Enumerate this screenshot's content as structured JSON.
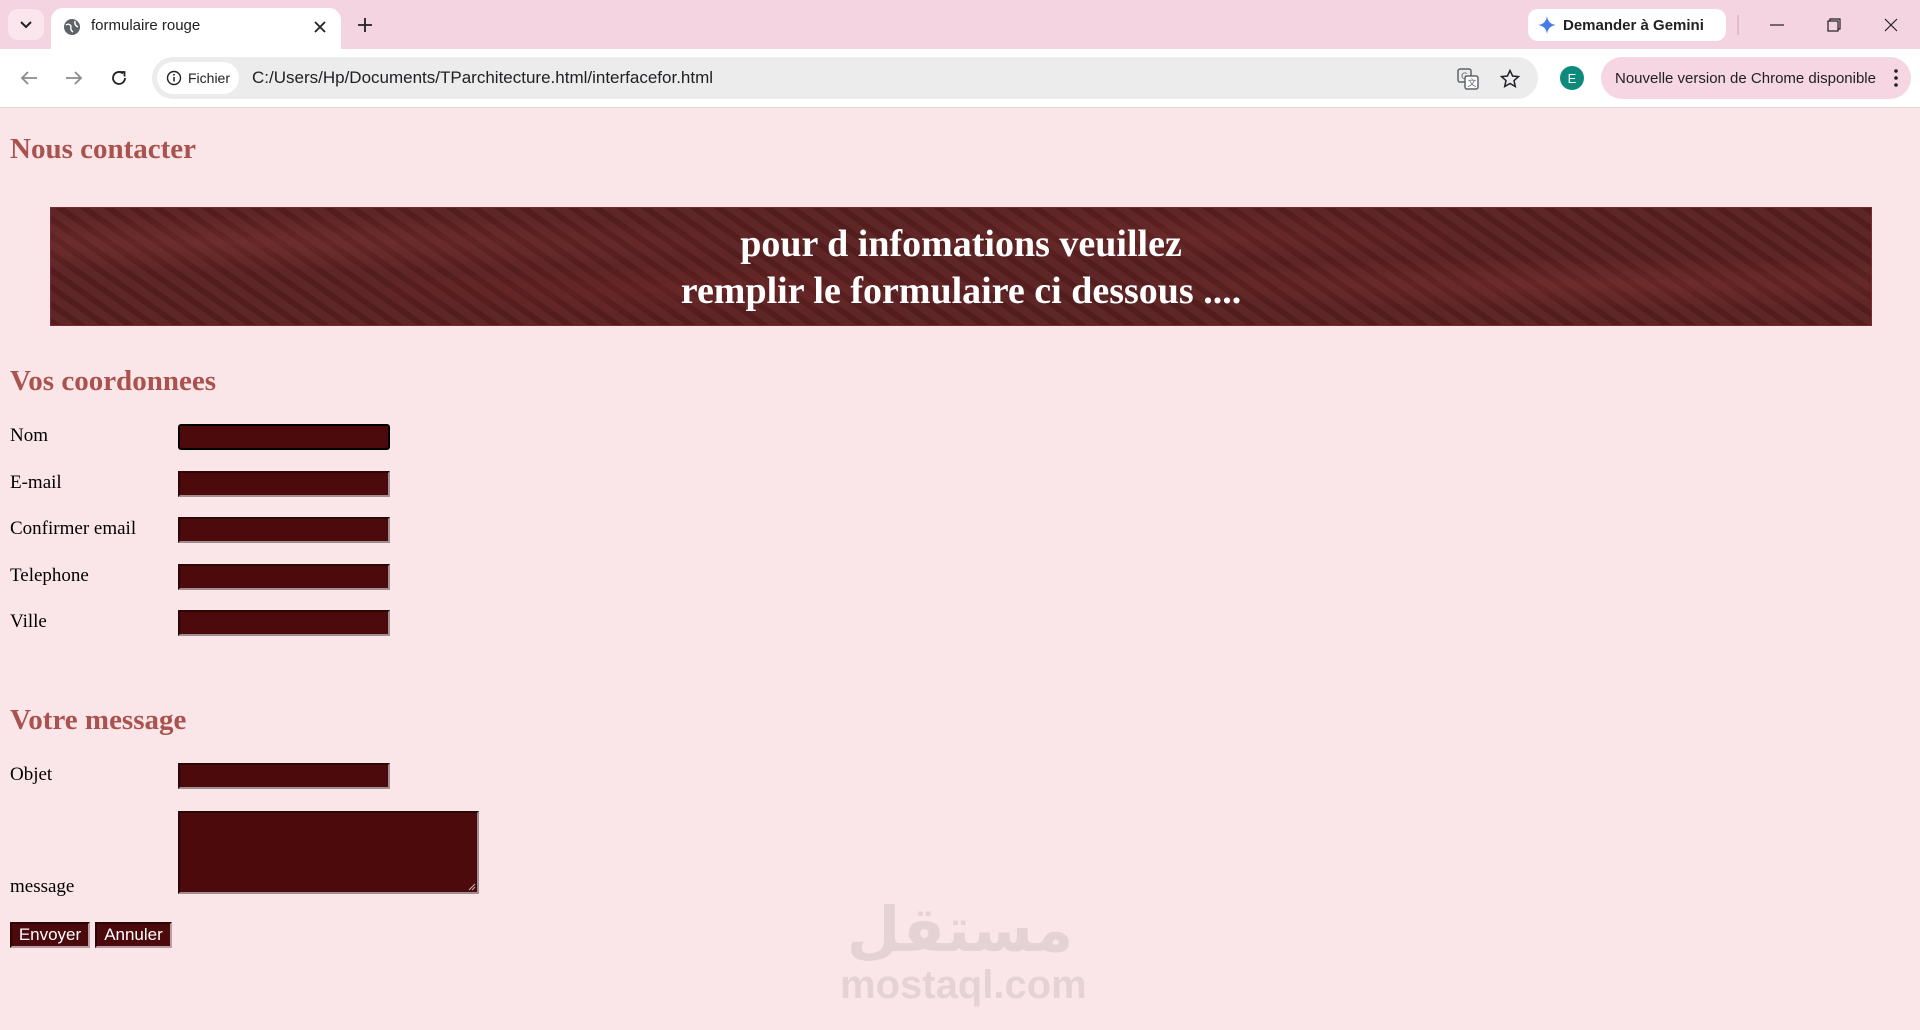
{
  "browser": {
    "tab_title": "formulaire rouge",
    "gemini_label": "Demander à Gemini",
    "security_chip": "Fichier",
    "url": "C:/Users/Hp/Documents/TParchitecture.html/interfacefor.html",
    "profile_initial": "E",
    "update_label": "Nouvelle version de Chrome disponible"
  },
  "page": {
    "title": "Nous contacter",
    "banner_line1": "pour d infomations veuillez",
    "banner_line2": "remplir le formulaire ci dessous ....",
    "section_coords": "Vos coordonnees",
    "fields": {
      "nom": "Nom",
      "email": "E-mail",
      "confirm_email": "Confirmer email",
      "telephone": "Telephone",
      "ville": "Ville"
    },
    "section_message": "Votre message",
    "objet": "Objet",
    "message": "message",
    "submit_label": "Envoyer",
    "reset_label": "Annuler"
  },
  "watermark": {
    "arabic": "مستقل",
    "latin": "mostaql.com"
  }
}
